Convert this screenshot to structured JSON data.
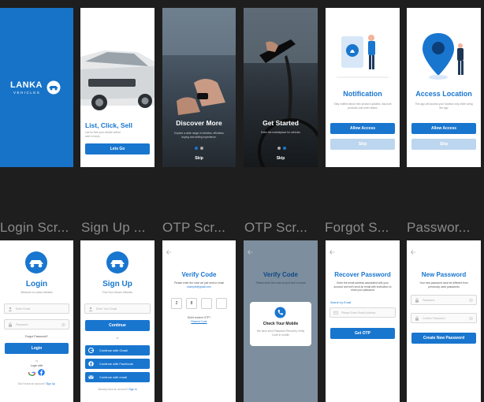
{
  "labels": [
    "Login Scr...",
    "Sign Up ...",
    "OTP Scr...",
    "OTP Scr...",
    "Forgot S...",
    "Passwor..."
  ],
  "splash": {
    "logo_title": "LANKA",
    "logo_sub": "VEHICLES"
  },
  "onboard1": {
    "title": "List, Click, Sell",
    "desc": "List for free your vehicle will be sold in hours",
    "button": "Lets Go"
  },
  "onboard2": {
    "title": "Discover More",
    "desc": "Explore a wide range of vehicles, effortless buying and selling experience.",
    "skip": "Skip"
  },
  "onboard3": {
    "title": "Get Started",
    "desc": "Enter the marketplace for vehicles",
    "skip": "Skip"
  },
  "notification": {
    "title": "Notification",
    "desc": "Stay notified about new product updates, discount products and order status",
    "allow": "Allow Access",
    "skip": "Skip"
  },
  "location": {
    "title": "Access Location",
    "desc": "This app will access your location only while using the app",
    "allow": "Allow Access",
    "skip": "Skip"
  },
  "login": {
    "title": "Login",
    "subtitle": "Welcome to Lanka Vehicles",
    "email_placeholder": "Enter Email",
    "password_placeholder": "Password",
    "forgot": "Forgot Password?",
    "button": "Login",
    "or": "or",
    "login_with": "Login with",
    "no_account": "Don't have an account?",
    "signup_link": "Sign Up"
  },
  "signup": {
    "title": "Sign Up",
    "subtitle": "Find Your Dream Vehicles",
    "email_placeholder": "Enter Your Email",
    "button": "Continue",
    "or": "or",
    "gmail": "Continue with Gmail",
    "facebook": "Continue with Facebook",
    "email": "Continue with email",
    "have_account": "Already have an account?",
    "signin_link": "Sign In"
  },
  "otp": {
    "title": "Verify Code",
    "desc": "Please enter the code we just sent to email",
    "email": "example@gmail.com",
    "digits": [
      "2",
      "8",
      "",
      ""
    ],
    "no_otp": "Didn't receive OTP?",
    "resend": "Resend Code"
  },
  "otp_modal": {
    "title": "Verify Code",
    "desc": "Please enter the code we just sent to email",
    "modal_title": "Check Your Mobile",
    "modal_desc": "We have send Password Recovery Verify Code in mobile"
  },
  "forgot": {
    "title": "Recover Password",
    "desc": "Enter the email address associated with your account and we'll send an email with instruction to reset your password",
    "label": "Search by Email",
    "placeholder": "Please Enter Email Address",
    "button": "Get OTP"
  },
  "newpass": {
    "title": "New Password",
    "desc": "Your new password must be different from previously used passwords",
    "password_placeholder": "Password",
    "confirm_placeholder": "Confirm Password",
    "button": "Create New Password"
  },
  "colors": {
    "primary": "#1976cf",
    "light": "#bdd6ef",
    "background": "#1e1e1e"
  }
}
